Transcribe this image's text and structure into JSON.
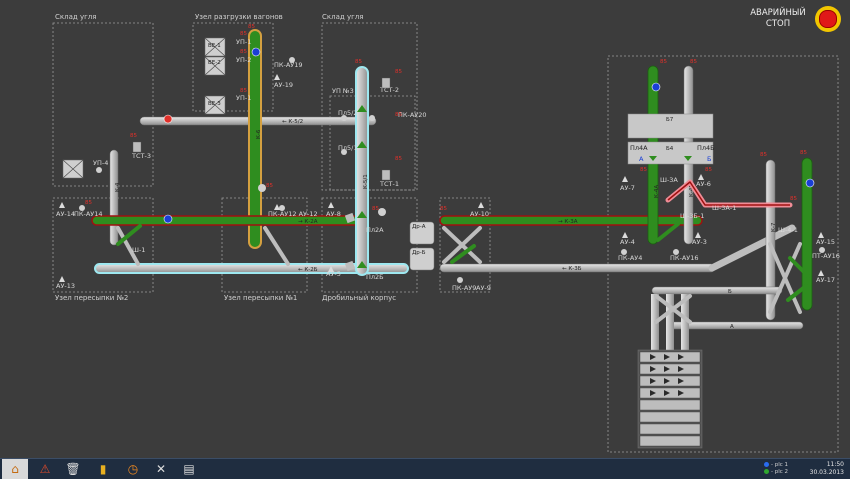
{
  "sections": {
    "coal_store_left": "Склад угля",
    "wagon_unload": "Узел разгрузки вагонов",
    "coal_store_right": "Склад угля",
    "transfer_2": "Узел пересыпки №2",
    "transfer_1": "Узел пересыпки №1",
    "crusher": "Дробильный корпус",
    "up3": "УП №3"
  },
  "emergency": {
    "label_line1": "АВАРИЙНЫЙ",
    "label_line2": "СТОП"
  },
  "conveyors": {
    "k52": "← К-5/2",
    "k2a": "→ К-2А",
    "k2b": "← К-2Б",
    "k3a": "→ К-3А",
    "k3b": "← К-3Б",
    "k4": "К-4",
    "k5": "К-5/1",
    "k6": "К-6",
    "k4a": "К-4А",
    "k4b": "К-4Б",
    "k7": "К-7",
    "k8": "К-8"
  },
  "equipment": {
    "up4": "УП-4",
    "tst3": "ТСТ-3",
    "ve1": "ВЕ-1",
    "ve2": "ВЕ-2",
    "ve3": "ВЕ-3",
    "up1": "УП-1",
    "up2": "УП-2",
    "up_left": "УП-1",
    "pk_au19": "ПК-АУ19",
    "au19": "АУ-19",
    "tst2": "ТСТ-2",
    "tst1": "ТСТ-1",
    "pk_au20": "ПК-АУ20",
    "pl52": "Пл5/2",
    "pl51": "Пл5/1",
    "au14": "АУ-14",
    "pk_au14": "ПК-АУ14",
    "sh1": "Ш-1",
    "au12": "ПК-АУ12 АУ-12",
    "au8": "АУ-8",
    "au5": "АУ-5",
    "pl2a": "Пл2А",
    "pl2b": "Пл2Б",
    "dra": "Др-А",
    "drb": "Др-Б",
    "au10": "АУ-10",
    "pk_au9": "ПК-АУ9",
    "au9": "АУ-9",
    "au13": "АУ-13",
    "b7": "Б7",
    "b4": "Б4",
    "pl4a": "Пл4А",
    "pl4b": "Пл4Б",
    "b_a": "А",
    "b_b": "Б",
    "au7": "АУ-7",
    "au6": "АУ-6",
    "au4": "АУ-4",
    "pk_au4": "ПК-АУ4",
    "au3": "АУ-3",
    "pk_au16": "ПК-АУ16",
    "sh3a": "Ш-3А-1",
    "sh3b": "Ш-3Б-1",
    "sh3a_2": "Ш-3А",
    "sh4": "Ш-4-1",
    "au15": "АУ-15",
    "pt_au16": "ПТ-АУ16",
    "au17": "АУ-17",
    "band_s": "Б",
    "band_a": "А"
  },
  "taskbar": {
    "home": "⌂",
    "alarm": "⚠",
    "trash": "🗑",
    "chart": "▮",
    "clock": "◷",
    "tools": "✕",
    "panel": "▤",
    "plc1": "- plc 1",
    "plc2": "- plc 2",
    "time": "11:50",
    "date": "30.03.2013"
  },
  "colors": {
    "background": "#3c3c3c",
    "belt_grey": "#bfbfbf",
    "belt_green": "#2b8c1d",
    "belt_red": "#a01010",
    "belt_cyan": "#9ee8f0",
    "belt_pink": "#f08c96",
    "alarm": "#e0302a",
    "motor_blue": "#1a3fd6",
    "taskbar": "#1f2d40"
  }
}
